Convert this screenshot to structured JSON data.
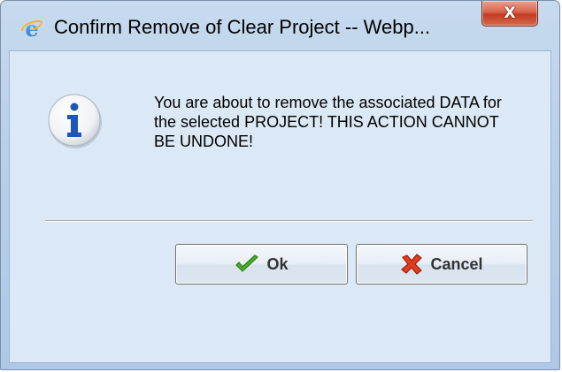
{
  "window": {
    "title": "Confirm Remove of Clear Project -- Webp...",
    "close_label": "X",
    "app_icon": "internet-explorer-icon"
  },
  "dialog": {
    "icon": "information-icon",
    "message": "You are about to remove the associated DATA for the selected PROJECT! THIS ACTION CANNOT BE UNDONE!"
  },
  "buttons": {
    "ok_label": "Ok",
    "ok_icon": "checkmark-icon",
    "cancel_label": "Cancel",
    "cancel_icon": "red-x-icon"
  },
  "colors": {
    "window_bg": "#b9d0ea",
    "client_bg": "#dbe8f5",
    "close_red": "#c43b21",
    "check_green": "#3c9a1e",
    "cancel_red": "#d4321c"
  }
}
